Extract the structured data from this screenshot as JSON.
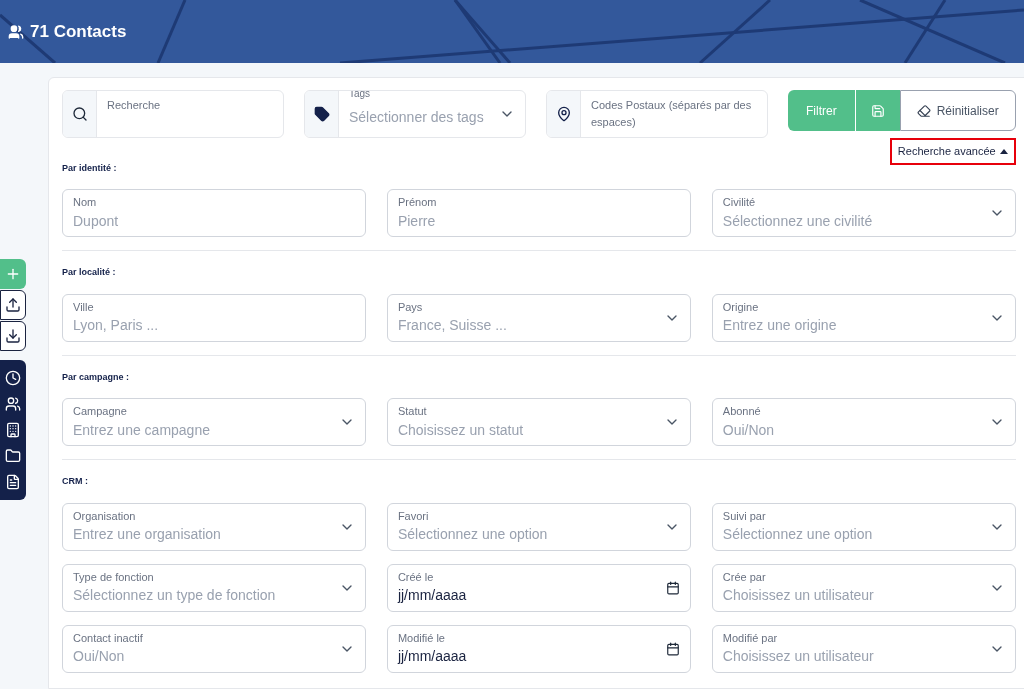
{
  "header": {
    "title": "71 Contacts"
  },
  "sidebar": {
    "actions": [
      {
        "kind": "add"
      },
      {
        "kind": "upload"
      },
      {
        "kind": "download"
      }
    ],
    "nav": [
      {
        "kind": "clock"
      },
      {
        "kind": "users"
      },
      {
        "kind": "building"
      },
      {
        "kind": "folder"
      },
      {
        "kind": "file"
      }
    ]
  },
  "search_bar": {
    "search": {
      "label": "Recherche"
    },
    "tags": {
      "label": "Tags",
      "placeholder": "Sélectionner des tags"
    },
    "postcodes": {
      "placeholder": "Codes Postaux (séparés par des espaces)"
    },
    "buttons": {
      "filter": "Filtrer",
      "reset": "Réinitialiser"
    },
    "advanced_toggle": {
      "label": "Recherche avancée",
      "expanded": true
    }
  },
  "sections": [
    {
      "title": "Par identité :",
      "fields": [
        {
          "kind": "text",
          "label": "Nom",
          "placeholder": "Dupont"
        },
        {
          "kind": "text",
          "label": "Prénom",
          "placeholder": "Pierre"
        },
        {
          "kind": "select",
          "label": "Civilité",
          "placeholder": "Sélectionnez une civilité"
        }
      ]
    },
    {
      "title": "Par localité :",
      "fields": [
        {
          "kind": "text",
          "label": "Ville",
          "placeholder": "Lyon, Paris ..."
        },
        {
          "kind": "select",
          "label": "Pays",
          "placeholder": "France, Suisse ..."
        },
        {
          "kind": "select",
          "label": "Origine",
          "placeholder": "Entrez une origine"
        }
      ]
    },
    {
      "title": "Par campagne :",
      "fields": [
        {
          "kind": "select",
          "label": "Campagne",
          "placeholder": "Entrez une campagne"
        },
        {
          "kind": "select",
          "label": "Statut",
          "placeholder": "Choisissez un statut"
        },
        {
          "kind": "select",
          "label": "Abonné",
          "placeholder": "Oui/Non"
        }
      ]
    },
    {
      "title": "CRM :",
      "fields": [
        {
          "kind": "select",
          "label": "Organisation",
          "placeholder": "Entrez une organisation"
        },
        {
          "kind": "select",
          "label": "Favori",
          "placeholder": "Sélectionnez une option"
        },
        {
          "kind": "select",
          "label": "Suivi par",
          "placeholder": "Sélectionnez une option"
        },
        {
          "kind": "select",
          "label": "Type de fonction",
          "placeholder": "Sélectionnez un type de fonction"
        },
        {
          "kind": "date",
          "label": "Créé le",
          "value": "jj/mm/aaaa"
        },
        {
          "kind": "select",
          "label": "Crée par",
          "placeholder": "Choisissez un utilisateur"
        },
        {
          "kind": "select",
          "label": "Contact inactif",
          "placeholder": "Oui/Non"
        },
        {
          "kind": "date",
          "label": "Modifié le",
          "value": "jj/mm/aaaa"
        },
        {
          "kind": "select",
          "label": "Modifié par",
          "placeholder": "Choisissez un utilisateur"
        }
      ]
    }
  ]
}
